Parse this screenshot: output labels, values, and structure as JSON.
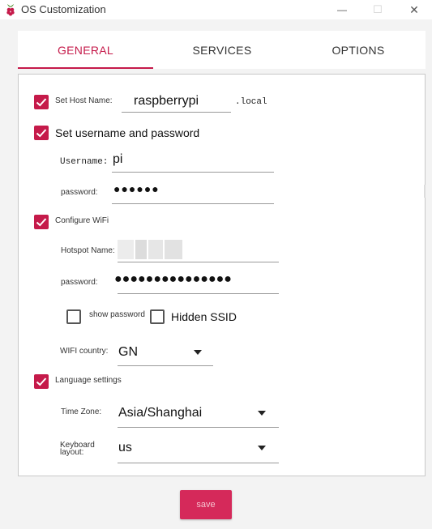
{
  "window": {
    "title": "OS Customization",
    "minimize_glyph": "—",
    "maximize_glyph": "☐",
    "close_glyph": "✕"
  },
  "tabs": [
    {
      "label": "GENERAL",
      "active": true
    },
    {
      "label": "SERVICES",
      "active": false
    },
    {
      "label": "OPTIONS",
      "active": false
    }
  ],
  "general": {
    "hostname": {
      "label": "Set Host Name:",
      "checked": true,
      "value": "raspberrypi",
      "suffix": ".local"
    },
    "user": {
      "label": "Set username and password",
      "checked": true,
      "username_label": "Username:",
      "username_value": "pi",
      "password_label": "password:",
      "password_masked": "●●●●●●"
    },
    "wifi": {
      "label": "Configure WiFi",
      "checked": true,
      "ssid_label": "Hotspot Name:",
      "password_label": "password:",
      "password_masked": "●●●●●●●●●●●●●●●",
      "show_password_label": "show password",
      "show_password_checked": false,
      "hidden_ssid_label": "Hidden SSID",
      "hidden_ssid_checked": false,
      "country_label": "WIFI country:",
      "country_value": "GN"
    },
    "locale": {
      "label": "Language settings",
      "checked": true,
      "timezone_label": "Time Zone:",
      "timezone_value": "Asia/Shanghai",
      "keyboard_label": "Keyboard layout:",
      "keyboard_value": "us"
    }
  },
  "save_label": "save",
  "colors": {
    "accent": "#c51a4a",
    "save_button": "#d5295a"
  }
}
